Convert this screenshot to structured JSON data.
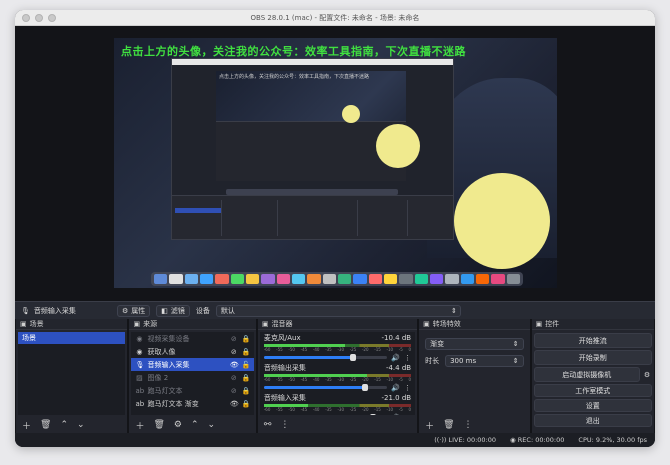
{
  "window": {
    "title": "OBS 28.0.1 (mac) - 配置文件: 未命名 - 场景: 未命名"
  },
  "preview": {
    "overlay_text": "点击上方的头像，关注我的公众号：效率工具指南，下次直播不迷路",
    "inner_overlay_text": "点击上方的头像，关注我的公众号：效率工具指南，下次直播不迷路"
  },
  "source_toolbar": {
    "source_name": "音频输入采集",
    "properties_label": "属性",
    "filters_label": "滤镜",
    "device_label": "设备",
    "device_value": "默认"
  },
  "scenes": {
    "title": "场景",
    "items": [
      "场景"
    ]
  },
  "sources": {
    "title": "来源",
    "items": [
      {
        "label": "视频采集设备",
        "state": "dim"
      },
      {
        "label": "获取人像",
        "state": "normal"
      },
      {
        "label": "音频输入采集",
        "state": "selected"
      },
      {
        "label": "图像 2",
        "state": "dim"
      },
      {
        "label": "跑马灯文本",
        "state": "dim"
      },
      {
        "label": "跑马灯文本 渐变",
        "state": "normal"
      }
    ]
  },
  "mixer": {
    "title": "混音器",
    "channels": [
      {
        "name": "麦克风/Aux",
        "db": "-10.4 dB",
        "level": 0.55,
        "volume": 0.72
      },
      {
        "name": "音频输出采集",
        "db": "-4.4 dB",
        "level": 0.7,
        "volume": 0.82
      },
      {
        "name": "音频输入采集",
        "db": "-21.0 dB",
        "level": 0.3,
        "volume": 0.88
      }
    ],
    "ticks": [
      "-60",
      "-55",
      "-50",
      "-45",
      "-40",
      "-35",
      "-30",
      "-25",
      "-20",
      "-15",
      "-10",
      "-5",
      "0"
    ]
  },
  "transitions": {
    "title": "转场特效",
    "selected": "渐变",
    "duration_label": "时长",
    "duration_value": "300 ms"
  },
  "controls": {
    "title": "控件",
    "start_stream": "开始推流",
    "start_record": "开始录制",
    "start_virtual_cam": "启动虚拟摄像机",
    "studio_mode": "工作室模式",
    "settings": "设置",
    "exit": "退出"
  },
  "status": {
    "live": "LIVE: 00:00:00",
    "rec": "REC: 00:00:00",
    "cpu": "CPU: 9.2%, 30.00 fps"
  }
}
